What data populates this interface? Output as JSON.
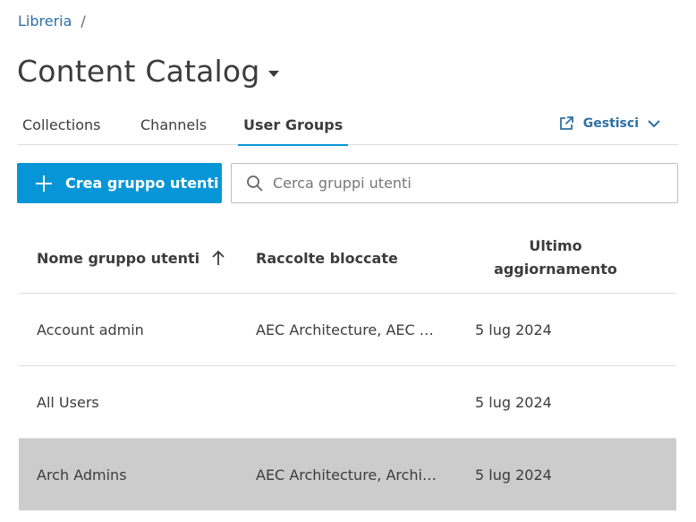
{
  "breadcrumb": {
    "root": "Libreria",
    "separator": "/"
  },
  "page": {
    "title": "Content Catalog"
  },
  "tabs": [
    {
      "label": "Collections",
      "active": false
    },
    {
      "label": "Channels",
      "active": false
    },
    {
      "label": "User Groups",
      "active": true
    }
  ],
  "manage": {
    "label": "Gestisci",
    "icon": "external-link-icon"
  },
  "actions": {
    "create_label": "Crea gruppo utenti",
    "search_placeholder": "Cerca gruppi utenti"
  },
  "table": {
    "columns": [
      "Nome gruppo utenti",
      "Raccolte bloccate",
      "Ultimo aggiornamento"
    ],
    "sort": {
      "column": "Nome gruppo utenti",
      "direction": "ascending"
    },
    "rows": [
      {
        "name": "Account admin",
        "collections": "AEC Architecture, AEC …",
        "updated": "5 lug 2024",
        "selected": false
      },
      {
        "name": "All Users",
        "collections": "",
        "updated": "5 lug 2024",
        "selected": false
      },
      {
        "name": "Arch Admins",
        "collections": "AEC Architecture, Archi…",
        "updated": "5 lug 2024",
        "selected": true
      }
    ]
  },
  "colors": {
    "accent": "#0696d7",
    "link": "#2d6fa5",
    "text": "#3c3c3c",
    "selected_row": "#cccccc",
    "divider": "#dedede"
  }
}
